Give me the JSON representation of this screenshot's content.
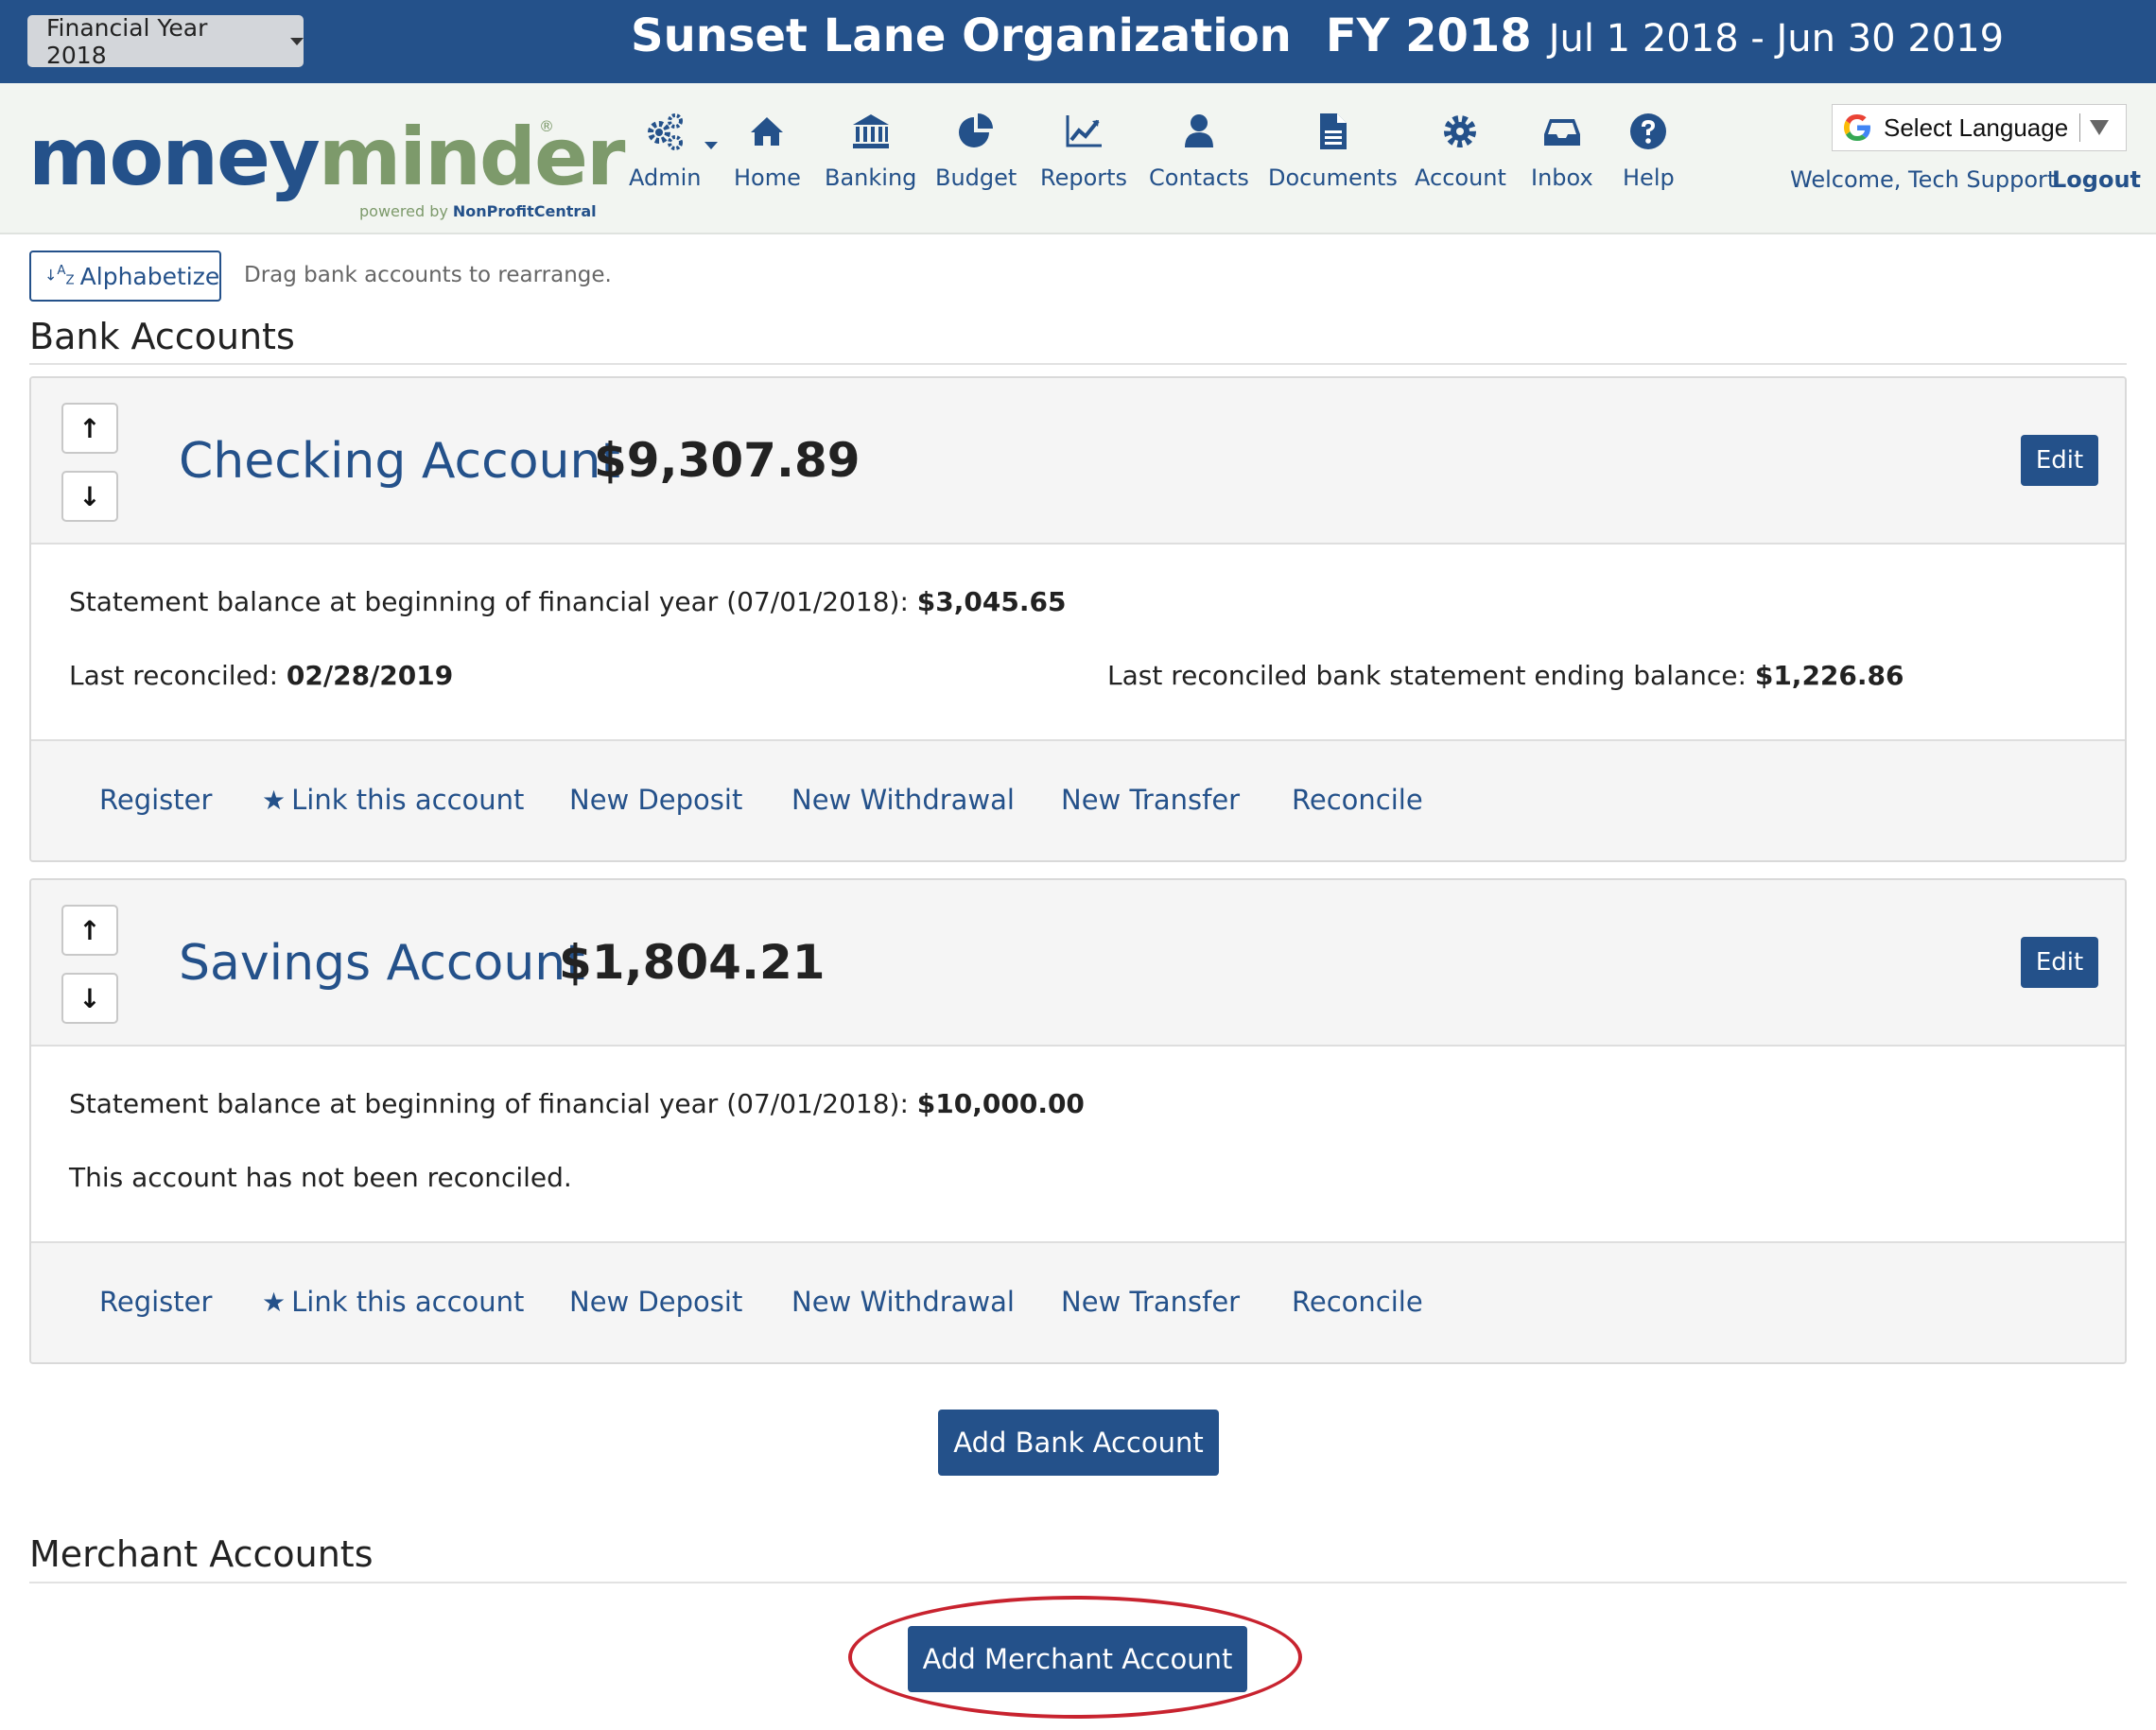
{
  "topbar": {
    "fy_selector": "Financial Year 2018",
    "org_name": "Sunset Lane Organization",
    "fy_label": "FY 2018",
    "date_range": "Jul 1 2018 - Jun 30 2019"
  },
  "logo": {
    "money": "money",
    "minder": "minder",
    "powered_by": "powered by",
    "powered_brand": "NonProfitCentral",
    "registered": "®"
  },
  "nav": {
    "admin": "Admin",
    "home": "Home",
    "banking": "Banking",
    "budget": "Budget",
    "reports": "Reports",
    "contacts": "Contacts",
    "documents": "Documents",
    "account": "Account",
    "inbox": "Inbox",
    "help": "Help"
  },
  "language": {
    "label": "Select Language"
  },
  "user": {
    "welcome": "Welcome, Tech Support",
    "logout": "Logout"
  },
  "toolbar": {
    "alphabetize": "Alphabetize",
    "drag_hint": "Drag bank accounts to rearrange."
  },
  "bank_section": {
    "title": "Bank Accounts",
    "add_button": "Add Bank Account"
  },
  "accounts": [
    {
      "name": "Checking Account",
      "balance": "$9,307.89",
      "edit": "Edit",
      "statement_label": "Statement balance at beginning of financial year (07/01/2018): ",
      "statement_value": "$3,045.65",
      "reconciled_label": "Last reconciled: ",
      "reconciled_value": "02/28/2019",
      "ending_label": "Last reconciled bank statement ending balance: ",
      "ending_value": "$1,226.86"
    },
    {
      "name": "Savings Account",
      "balance": "$1,804.21",
      "edit": "Edit",
      "statement_label": "Statement balance at beginning of financial year (07/01/2018): ",
      "statement_value": "$10,000.00",
      "not_reconciled": "This account has not been reconciled."
    }
  ],
  "account_actions": {
    "register": "Register",
    "link": "Link this account",
    "deposit": "New Deposit",
    "withdrawal": "New Withdrawal",
    "transfer": "New Transfer",
    "reconcile": "Reconcile"
  },
  "merchant_section": {
    "title": "Merchant Accounts",
    "add_button": "Add Merchant Account"
  },
  "colors": {
    "brand_blue": "#24518a",
    "brand_green": "#7d9a6b",
    "highlight_red": "#c8232f"
  }
}
